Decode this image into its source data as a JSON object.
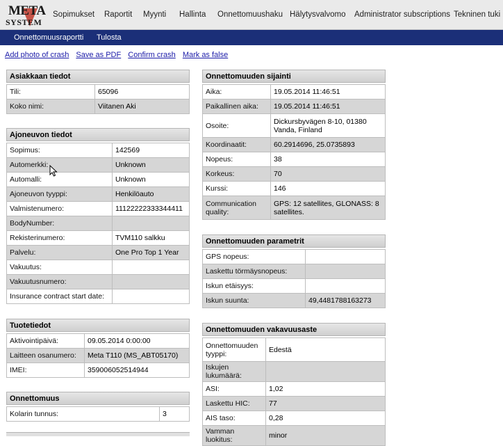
{
  "logo": {
    "line1": "META",
    "line2": "SYSTEM"
  },
  "nav": {
    "items": [
      "Sopimukset",
      "Raportit",
      "Myynti",
      "Hallinta",
      "Onnettomuushaku",
      "Hälytysvalvomo",
      "Administrator subscriptions",
      "Tekninen tuki"
    ]
  },
  "subnav": {
    "items": [
      "Onnettomuusraportti",
      "Tulosta"
    ]
  },
  "actions": [
    "Add photo of crash",
    "Save as PDF",
    "Confirm crash",
    "Mark as false"
  ],
  "customer": {
    "title": "Asiakkaan tiedot",
    "rows": [
      {
        "label": "Tili:",
        "value": "65096"
      },
      {
        "label": "Koko nimi:",
        "value": "Viitanen Aki"
      }
    ]
  },
  "vehicle": {
    "title": "Ajoneuvon tiedot",
    "rows": [
      {
        "label": "Sopimus:",
        "value": "142569"
      },
      {
        "label": "Automerkki:",
        "value": "Unknown"
      },
      {
        "label": "Automalli:",
        "value": "Unknown"
      },
      {
        "label": "Ajoneuvon tyyppi:",
        "value": "Henkilöauto"
      },
      {
        "label": "Valmistenumero:",
        "value": "11122222333344411"
      },
      {
        "label": "BodyNumber:",
        "value": ""
      },
      {
        "label": "Rekisterinumero:",
        "value": "TVM110 salkku"
      },
      {
        "label": "Palvelu:",
        "value": "One Pro Top 1 Year"
      },
      {
        "label": "Vakuutus:",
        "value": ""
      },
      {
        "label": "Vakuutusnumero:",
        "value": ""
      },
      {
        "label": "Insurance contract start date:",
        "value": ""
      }
    ]
  },
  "product": {
    "title": "Tuotetiedot",
    "rows": [
      {
        "label": "Aktivointipäivä:",
        "value": "09.05.2014 0:00:00"
      },
      {
        "label": "Laitteen osanumero:",
        "value": "Meta T110 (MS_ABT05170)"
      },
      {
        "label": "IMEI:",
        "value": "359006052514944"
      }
    ]
  },
  "accident": {
    "title": "Onnettomuus",
    "rows": [
      {
        "label": "Kolarin tunnus:",
        "value": "3"
      }
    ]
  },
  "location": {
    "title": "Onnettomuuden sijainti",
    "rows": [
      {
        "label": "Aika:",
        "value": "19.05.2014 11:46:51"
      },
      {
        "label": "Paikallinen aika:",
        "value": "19.05.2014 11:46:51"
      },
      {
        "label": "Osoite:",
        "value": "Dickursbyvägen 8-10, 01380 Vanda, Finland"
      },
      {
        "label": "Koordinaatit:",
        "value": "60.2914696, 25.0735893"
      },
      {
        "label": "Nopeus:",
        "value": "38"
      },
      {
        "label": "Korkeus:",
        "value": "70"
      },
      {
        "label": "Kurssi:",
        "value": "146"
      },
      {
        "label": "Communication quality:",
        "value": "GPS: 12 satellites, GLONASS: 8 satellites."
      }
    ]
  },
  "params": {
    "title": "Onnettomuuden parametrit",
    "rows": [
      {
        "label": "GPS nopeus:",
        "value": ""
      },
      {
        "label": "Laskettu törmäysnopeus:",
        "value": ""
      },
      {
        "label": "Iskun etäisyys:",
        "value": ""
      },
      {
        "label": "Iskun suunta:",
        "value": "49,4481788163273"
      }
    ]
  },
  "severity": {
    "title": "Onnettomuuden vakavuusaste",
    "rows": [
      {
        "label": "Onnettomuuden tyyppi:",
        "value": "Edestä"
      },
      {
        "label": "Iskujen lukumäärä:",
        "value": ""
      },
      {
        "label": "ASI:",
        "value": "1,02"
      },
      {
        "label": "Laskettu HIC:",
        "value": "77"
      },
      {
        "label": "AIS taso:",
        "value": "0,28"
      },
      {
        "label": "Vamman luokitus:",
        "value": "minor"
      }
    ]
  }
}
